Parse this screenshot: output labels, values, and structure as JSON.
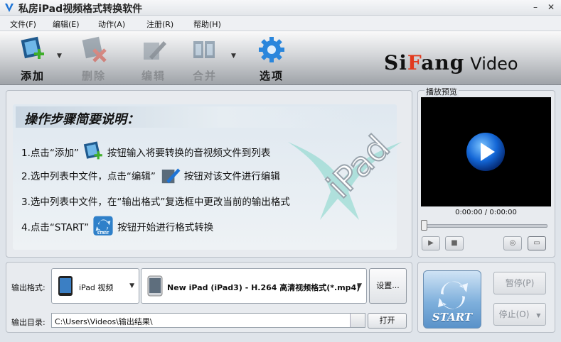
{
  "window": {
    "title": "私房iPad视频格式转换软件",
    "minimize": "–",
    "close": "✕"
  },
  "menu": [
    "文件(F)",
    "编辑(E)",
    "动作(A)",
    "注册(R)",
    "帮助(H)"
  ],
  "toolbar": {
    "add": "添加",
    "delete": "删除",
    "edit": "编辑",
    "merge": "合并",
    "options": "选项",
    "dropdown_glyph": "▼"
  },
  "brand": {
    "pre": "Si",
    "accent": "F",
    "post": "ang",
    "video": "Video"
  },
  "guide": {
    "title": "操作步骤简要说明：",
    "step1_a": "1.点击“添加”",
    "step1_b": "按钮输入将要转换的音视频文件到列表",
    "step2_a": "2.选中列表中文件，点击“编辑”",
    "step2_b": "按钮对该文件进行编辑",
    "step3": "3.选中列表中文件，在“输出格式”复选框中更改当前的输出格式",
    "step4_a": "4.点击“START”",
    "step4_b": "按钮开始进行格式转换",
    "start_icon_label": "START",
    "watermark": "iPad"
  },
  "preview": {
    "label": "播放预览",
    "time": "0:00:00 / 0:00:00"
  },
  "output": {
    "format_label": "输出格式:",
    "device": "iPad 视频",
    "profile": "New iPad (iPad3) - H.264 高清视频格式(*.mp4)",
    "settings_button": "设置...",
    "dir_label": "输出目录:",
    "dir_value": "C:\\Users\\Videos\\输出结果\\",
    "open_button": "打开"
  },
  "convert": {
    "start": "START",
    "pause": "暂停(P)",
    "stop": "停止(O)",
    "stop_dropdown": "▼"
  },
  "colors": {
    "accent_blue": "#1e74d6",
    "brand_red": "#e23a1e",
    "add_green": "#3fae2a",
    "delete_red": "#d43a2a"
  }
}
